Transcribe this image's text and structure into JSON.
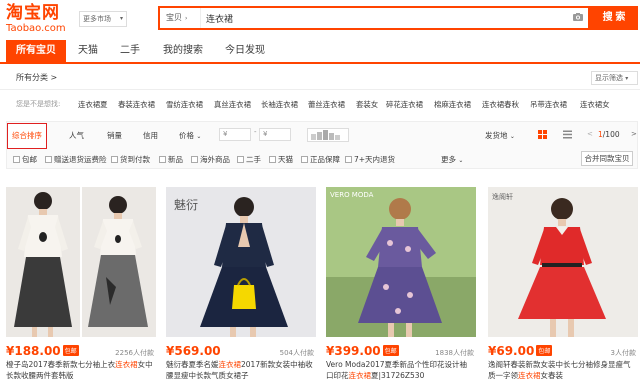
{
  "brand": {
    "logo_cn": "淘宝网",
    "logo_en": "Taobao.com",
    "color": "#ff4400"
  },
  "market": {
    "label": "更多市场"
  },
  "search": {
    "type_label": "宝贝",
    "value": "连衣裙",
    "button_label": "搜 索"
  },
  "tabs": [
    "所有宝贝",
    "天猫",
    "二手",
    "我的搜索",
    "今日发现"
  ],
  "category": {
    "all_label": "所有分类 >",
    "display_filter": "显示筛选"
  },
  "keywords": {
    "label": "您是不是想找:",
    "items": [
      "连衣裙夏",
      "春装连衣裙",
      "雪纺连衣裙",
      "真丝连衣裙",
      "长袖连衣裙",
      "蕾丝连衣裙",
      "套装女",
      "碎花连衣裙",
      "棉麻连衣裙",
      "连衣裙春秋",
      "吊带连衣裙",
      "连衣裙女"
    ]
  },
  "sort": {
    "options": [
      "综合排序",
      "人气",
      "销量",
      "信用",
      "价格"
    ],
    "price_from_placeholder": "¥",
    "price_to_placeholder": "¥",
    "dash": "-",
    "shipping": "发货地",
    "pager_prev": "<",
    "page_current": "1",
    "page_total": "/100",
    "pager_next": ">"
  },
  "checkboxes": [
    "包邮",
    "赠送退货运费险",
    "货到付款",
    "新品",
    "海外商品",
    "二手",
    "天猫",
    "正品保障",
    "7+天内退货"
  ],
  "more_label": "更多",
  "merge_label": "合并同款宝贝",
  "products": [
    {
      "price": "¥188.00",
      "baoyou": "包邮",
      "sales": "2256人付款",
      "title_pre": "橙子岛2017春季新款七分袖上衣",
      "title_hl": "连衣裙",
      "title_post": "女中长款收腰两件套韩版",
      "bg": "#e9e6e2"
    },
    {
      "price": "¥569.00",
      "baoyou": "",
      "sales": "504人付款",
      "title_pre": "魅衍春夏季名媛",
      "title_hl": "连衣裙",
      "title_post": "2017新款女装中袖收腰显瘦中长款气质女裙子",
      "bg": "#e6e6e8",
      "brand_mark": "魅衍"
    },
    {
      "price": "¥399.00",
      "baoyou": "包邮",
      "sales": "1838人付款",
      "title_pre": "Vero Moda2017夏季新品个性印花设计袖口印花",
      "title_hl": "连衣裙",
      "title_post": "夏|31726Z530",
      "bg": "#9fbf7a",
      "brand_mark": "VERO MODA"
    },
    {
      "price": "¥69.00",
      "baoyou": "包邮",
      "sales": "3人付款",
      "title_pre": "逸阁轩春装新款女装中长七分袖修身显瘦气质一字领",
      "title_hl": "连衣裙",
      "title_post": "女春装",
      "bg": "#eceae6",
      "brand_mark": "逸阁轩"
    }
  ]
}
